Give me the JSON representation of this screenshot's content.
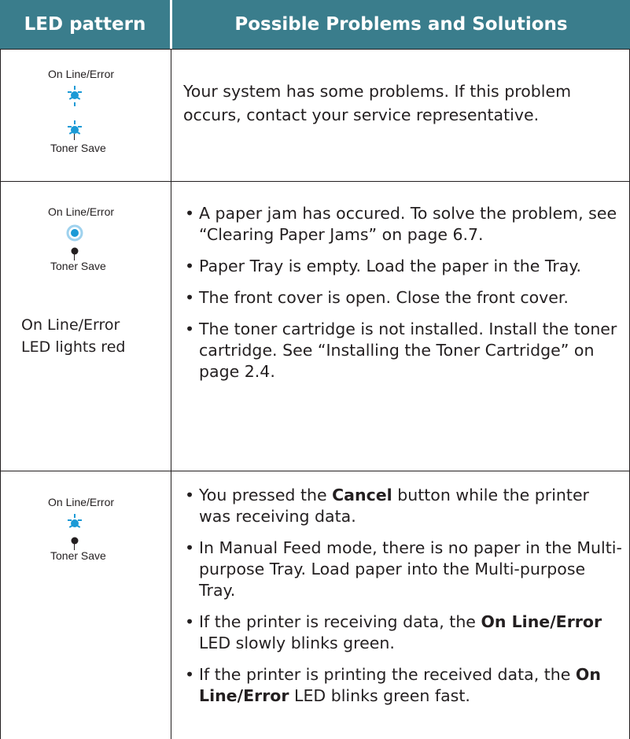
{
  "header": {
    "col1": "LED pattern",
    "col2": "Possible Problems and Solutions"
  },
  "colors": {
    "header_bg": "#3a7d8c",
    "led_blue": "#1b9ad6",
    "led_off": "#231f20"
  },
  "rows": [
    {
      "led_top_label": "On Line/Error",
      "led_bottom_label": "Toner Save",
      "led_state": "both-blinking",
      "solution": "Your system has some problems. If this problem occurs, contact your service representative."
    },
    {
      "led_top_label": "On Line/Error",
      "led_bottom_label": "Toner Save",
      "led_state": "online-on-toner-off",
      "side_text_line1": "On Line/Error",
      "side_text_line2": "LED lights red",
      "bullets": [
        "A paper jam has occured. To solve the problem, see “Clearing Paper Jams” on page 6.7.",
        "Paper Tray is empty. Load the paper in the Tray.",
        "The front cover is open. Close the front cover.",
        "The toner cartridge is not installed. Install the toner cartridge. See “Installing the Toner Cartridge” on page 2.4."
      ]
    },
    {
      "led_top_label": "On Line/Error",
      "led_bottom_label": "Toner Save",
      "led_state": "online-blinking-toner-off",
      "bullets": [
        {
          "pre": "You pressed the ",
          "bold": "Cancel",
          "post": " button while the printer was receiving data."
        },
        {
          "pre": "In Manual Feed mode, there is no paper in the Multi-purpose Tray. Load paper into the Multi-purpose Tray.",
          "bold": "",
          "post": ""
        },
        {
          "pre": "If the printer is receiving data, the ",
          "bold": "On Line/Error",
          "post": " LED slowly blinks green."
        },
        {
          "pre": "If the printer is printing the received data, the ",
          "bold": "On Line/Error",
          "post": " LED blinks green fast."
        }
      ]
    }
  ]
}
